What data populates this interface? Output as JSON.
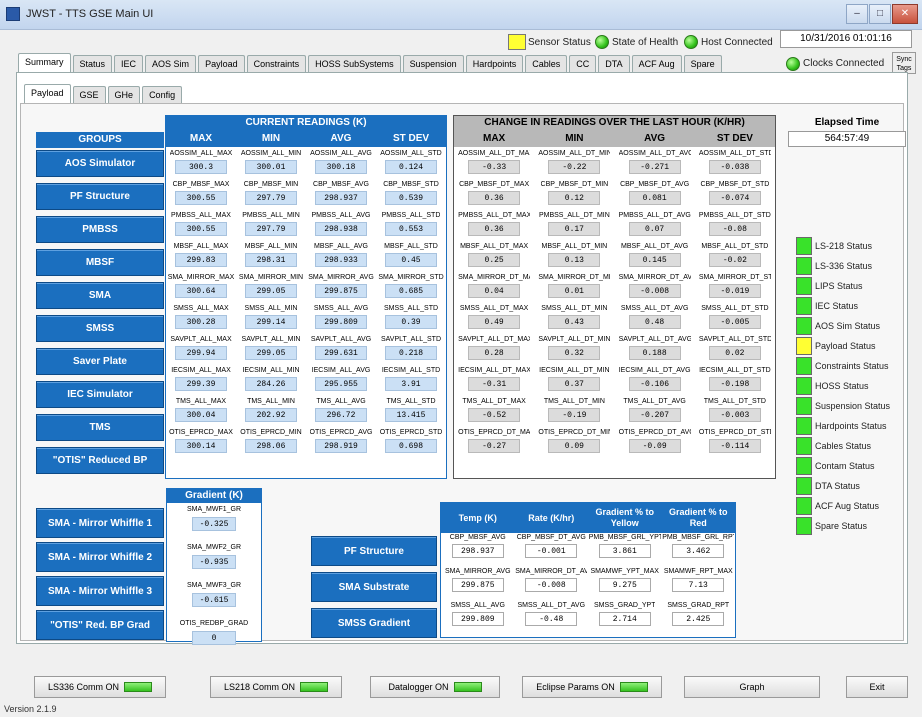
{
  "window": {
    "title": "JWST - TTS GSE Main UI"
  },
  "header": {
    "sensor_status": "Sensor Status",
    "state_of_health": "State of Health",
    "host_connected": "Host Connected",
    "datetime": "10/31/2016 01:01:16",
    "clocks_connected": "Clocks Connected",
    "sync_tags": "Sync Tags"
  },
  "tabs": [
    "Summary",
    "Status",
    "IEC",
    "AOS Sim",
    "Payload",
    "Constraints",
    "HOSS SubSystems",
    "Suspension",
    "Hardpoints",
    "Cables",
    "CC",
    "DTA",
    "ACF Aug",
    "Spare"
  ],
  "subtabs": [
    "Payload",
    "GSE",
    "GHe",
    "Config"
  ],
  "groups": {
    "header": "GROUPS",
    "items": [
      "AOS Simulator",
      "PF Structure",
      "PMBSS",
      "MBSF",
      "SMA",
      "SMSS",
      "Saver Plate",
      "IEC Simulator",
      "TMS",
      "\"OTIS\" Reduced BP"
    ]
  },
  "current": {
    "title": "CURRENT READINGS (K)",
    "cols": [
      "MAX",
      "MIN",
      "AVG",
      "ST DEV"
    ],
    "rows": [
      [
        [
          "AOSSIM_ALL_MAX",
          "300.3"
        ],
        [
          "AOSSIM_ALL_MIN",
          "300.01"
        ],
        [
          "AOSSIM_ALL_AVG",
          "300.18"
        ],
        [
          "AOSSIM_ALL_STD",
          "0.124"
        ]
      ],
      [
        [
          "CBP_MBSF_MAX",
          "300.55"
        ],
        [
          "CBP_MBSF_MIN",
          "297.79"
        ],
        [
          "CBP_MBSF_AVG",
          "298.937"
        ],
        [
          "CBP_MBSF_STD",
          "0.539"
        ]
      ],
      [
        [
          "PMBSS_ALL_MAX",
          "300.55"
        ],
        [
          "PMBSS_ALL_MIN",
          "297.79"
        ],
        [
          "PMBSS_ALL_AVG",
          "298.938"
        ],
        [
          "PMBSS_ALL_STD",
          "0.553"
        ]
      ],
      [
        [
          "MBSF_ALL_MAX",
          "299.83"
        ],
        [
          "MBSF_ALL_MIN",
          "298.31"
        ],
        [
          "MBSF_ALL_AVG",
          "298.933"
        ],
        [
          "MBSF_ALL_STD",
          "0.45"
        ]
      ],
      [
        [
          "SMA_MIRROR_MAX",
          "300.64"
        ],
        [
          "SMA_MIRROR_MIN",
          "299.05"
        ],
        [
          "SMA_MIRROR_AVG",
          "299.875"
        ],
        [
          "SMA_MIRROR_STD",
          "0.685"
        ]
      ],
      [
        [
          "SMSS_ALL_MAX",
          "300.28"
        ],
        [
          "SMSS_ALL_MIN",
          "299.14"
        ],
        [
          "SMSS_ALL_AVG",
          "299.809"
        ],
        [
          "SMSS_ALL_STD",
          "0.39"
        ]
      ],
      [
        [
          "SAVPLT_ALL_MAX",
          "299.94"
        ],
        [
          "SAVPLT_ALL_MIN",
          "299.05"
        ],
        [
          "SAVPLT_ALL_AVG",
          "299.631"
        ],
        [
          "SAVPLT_ALL_STD",
          "0.218"
        ]
      ],
      [
        [
          "IECSIM_ALL_MAX",
          "299.39"
        ],
        [
          "IECSIM_ALL_MIN",
          "284.26"
        ],
        [
          "IECSIM_ALL_AVG",
          "295.955"
        ],
        [
          "IECSIM_ALL_STD",
          "3.91"
        ]
      ],
      [
        [
          "TMS_ALL_MAX",
          "300.04"
        ],
        [
          "TMS_ALL_MIN",
          "202.92"
        ],
        [
          "TMS_ALL_AVG",
          "296.72"
        ],
        [
          "TMS_ALL_STD",
          "13.415"
        ]
      ],
      [
        [
          "OTIS_EPRCD_MAX",
          "300.14"
        ],
        [
          "OTIS_EPRCD_MIN",
          "298.06"
        ],
        [
          "OTIS_EPRCD_AVG",
          "298.919"
        ],
        [
          "OTIS_EPRCD_STD",
          "0.698"
        ]
      ]
    ]
  },
  "change": {
    "title": "CHANGE IN READINGS OVER THE LAST HOUR (K/HR)",
    "cols": [
      "MAX",
      "MIN",
      "AVG",
      "ST DEV"
    ],
    "rows": [
      [
        [
          "AOSSIM_ALL_DT_MAX",
          "-0.33"
        ],
        [
          "AOSSIM_ALL_DT_MIN",
          "-0.22"
        ],
        [
          "AOSSIM_ALL_DT_AVG",
          "-0.271"
        ],
        [
          "AOSSIM_ALL_DT_STD",
          "-0.038"
        ]
      ],
      [
        [
          "CBP_MBSF_DT_MAX",
          "0.36"
        ],
        [
          "CBP_MBSF_DT_MIN",
          "0.12"
        ],
        [
          "CBP_MBSF_DT_AVG",
          "0.081"
        ],
        [
          "CBP_MBSF_DT_STD",
          "-0.074"
        ]
      ],
      [
        [
          "PMBSS_ALL_DT_MAX",
          "0.36"
        ],
        [
          "PMBSS_ALL_DT_MIN",
          "0.17"
        ],
        [
          "PMBSS_ALL_DT_AVG",
          "0.07"
        ],
        [
          "PMBSS_ALL_DT_STD",
          "-0.08"
        ]
      ],
      [
        [
          "MBSF_ALL_DT_MAX",
          "0.25"
        ],
        [
          "MBSF_ALL_DT_MIN",
          "0.13"
        ],
        [
          "MBSF_ALL_DT_AVG",
          "0.145"
        ],
        [
          "MBSF_ALL_DT_STD",
          "-0.02"
        ]
      ],
      [
        [
          "SMA_MIRROR_DT_MAX",
          "0.04"
        ],
        [
          "SMA_MIRROR_DT_MIN",
          "0.01"
        ],
        [
          "SMA_MIRROR_DT_AVG",
          "-0.008"
        ],
        [
          "SMA_MIRROR_DT_STD",
          "-0.019"
        ]
      ],
      [
        [
          "SMSS_ALL_DT_MAX",
          "0.49"
        ],
        [
          "SMSS_ALL_DT_MIN",
          "0.43"
        ],
        [
          "SMSS_ALL_DT_AVG",
          "0.48"
        ],
        [
          "SMSS_ALL_DT_STD",
          "-0.005"
        ]
      ],
      [
        [
          "SAVPLT_ALL_DT_MAX",
          "0.28"
        ],
        [
          "SAVPLT_ALL_DT_MIN",
          "0.32"
        ],
        [
          "SAVPLT_ALL_DT_AVG",
          "0.188"
        ],
        [
          "SAVPLT_ALL_DT_STD",
          "0.02"
        ]
      ],
      [
        [
          "IECSIM_ALL_DT_MAX",
          "-0.31"
        ],
        [
          "IECSIM_ALL_DT_MIN",
          "0.37"
        ],
        [
          "IECSIM_ALL_DT_AVG",
          "-0.106"
        ],
        [
          "IECSIM_ALL_DT_STD",
          "-0.198"
        ]
      ],
      [
        [
          "TMS_ALL_DT_MAX",
          "-0.52"
        ],
        [
          "TMS_ALL_DT_MIN",
          "-0.19"
        ],
        [
          "TMS_ALL_DT_AVG",
          "-0.207"
        ],
        [
          "TMS_ALL_DT_STD",
          "-0.003"
        ]
      ],
      [
        [
          "OTIS_EPRCD_DT_MAX",
          "-0.27"
        ],
        [
          "OTIS_EPRCD_DT_MIN",
          "0.09"
        ],
        [
          "OTIS_EPRCD_DT_AVG",
          "-0.09"
        ],
        [
          "OTIS_EPRCD_DT_STD",
          "-0.114"
        ]
      ]
    ]
  },
  "elapsed": {
    "label": "Elapsed Time",
    "value": "564:57:49"
  },
  "status_list": [
    {
      "label": "LS-218 Status",
      "color": "#39e22a"
    },
    {
      "label": "LS-336 Status",
      "color": "#39e22a"
    },
    {
      "label": "LIPS Status",
      "color": "#39e22a"
    },
    {
      "label": "IEC Status",
      "color": "#39e22a"
    },
    {
      "label": "AOS Sim Status",
      "color": "#39e22a"
    },
    {
      "label": "Payload Status",
      "color": "#ffff33"
    },
    {
      "label": "Constraints Status",
      "color": "#39e22a"
    },
    {
      "label": "HOSS Status",
      "color": "#39e22a"
    },
    {
      "label": "Suspension Status",
      "color": "#39e22a"
    },
    {
      "label": "Hardpoints Status",
      "color": "#39e22a"
    },
    {
      "label": "Cables Status",
      "color": "#39e22a"
    },
    {
      "label": "Contam Status",
      "color": "#39e22a"
    },
    {
      "label": "DTA Status",
      "color": "#39e22a"
    },
    {
      "label": "ACF Aug Status",
      "color": "#39e22a"
    },
    {
      "label": "Spare Status",
      "color": "#39e22a"
    }
  ],
  "lower_groups": [
    "SMA - Mirror Whiffle 1",
    "SMA - Mirror Whiffle 2",
    "SMA - Mirror Whiffle 3",
    "\"OTIS\" Red. BP Grad"
  ],
  "gradient": {
    "title": "Gradient (K)",
    "items": [
      {
        "label": "SMA_MWF1_GR",
        "value": "-0.325"
      },
      {
        "label": "SMA_MWF2_GR",
        "value": "-0.935"
      },
      {
        "label": "SMA_MWF3_GR",
        "value": "-0.615"
      },
      {
        "label": "OTIS_REDBP_GRAD",
        "value": "0"
      }
    ]
  },
  "bottom_groups": [
    "PF Structure",
    "SMA Substrate",
    "SMSS Gradient"
  ],
  "bottom_table": {
    "cols": [
      "Temp (K)",
      "Rate (K/hr)",
      "Gradient % to Yellow",
      "Gradient % to Red"
    ],
    "rows": [
      [
        [
          "CBP_MBSF_AVG",
          "298.937"
        ],
        [
          "CBP_MBSF_DT_AVG",
          "-0.001"
        ],
        [
          "PMB_MBSF_GRL_YPT",
          "3.861"
        ],
        [
          "PMB_MBSF_GRL_RPT",
          "3.462"
        ]
      ],
      [
        [
          "SMA_MIRROR_AVG",
          "299.875"
        ],
        [
          "SMA_MIRROR_DT_AVG",
          "-0.008"
        ],
        [
          "SMAMWF_YPT_MAX",
          "9.275"
        ],
        [
          "SMAMWF_RPT_MAX",
          "7.13"
        ]
      ],
      [
        [
          "SMSS_ALL_AVG",
          "299.809"
        ],
        [
          "SMSS_ALL_DT_AVG",
          "-0.48"
        ],
        [
          "SMSS_GRAD_YPT",
          "2.714"
        ],
        [
          "SMSS_GRAD_RPT",
          "2.425"
        ]
      ]
    ]
  },
  "footer": {
    "ls336": "LS336 Comm  ON",
    "ls218": "LS218 Comm ON",
    "datalogger": "Datalogger  ON",
    "eclipse": "Eclipse Params  ON",
    "graph": "Graph",
    "exit": "Exit",
    "version": "Version 2.1.9"
  }
}
